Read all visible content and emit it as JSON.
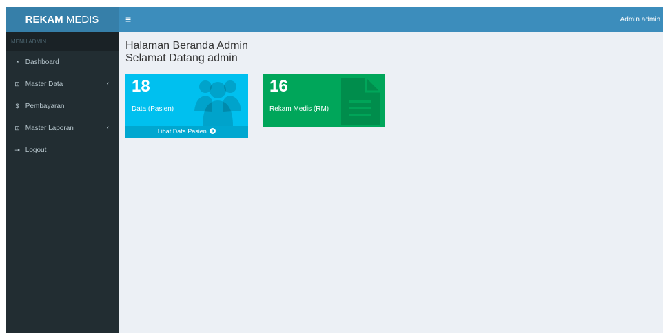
{
  "header": {
    "logo_bold": "REKAM",
    "logo_rest": " MEDIS",
    "toggle_icon": "≡",
    "user_name": "Admin admin"
  },
  "sidebar": {
    "header": "MENU ADMIN",
    "items": [
      {
        "label": "Dashboard",
        "icon": "dashboard-icon",
        "glyph": "◔"
      },
      {
        "label": "Master Data",
        "icon": "folder-icon",
        "glyph": "⊡",
        "chevron": "‹"
      },
      {
        "label": "Pembayaran",
        "icon": "dollar-icon",
        "glyph": "$"
      },
      {
        "label": "Master Laporan",
        "icon": "folder-icon",
        "glyph": "⊡",
        "chevron": "‹"
      },
      {
        "label": "Logout",
        "icon": "logout-icon",
        "glyph": "⇥"
      }
    ]
  },
  "main": {
    "title_line1": "Halaman Beranda Admin",
    "title_line2": "Selamat Datang admin",
    "boxes": [
      {
        "number": "18",
        "label": "Data (Pasien)",
        "footer": "Lihat Data Pasien",
        "footer_icon": "arrow-circle-right-icon",
        "icon": "users-icon",
        "color": "#00c0ef"
      },
      {
        "number": "16",
        "label": "Rekam Medis (RM)",
        "icon": "file-icon",
        "color": "#00a65a"
      }
    ]
  }
}
